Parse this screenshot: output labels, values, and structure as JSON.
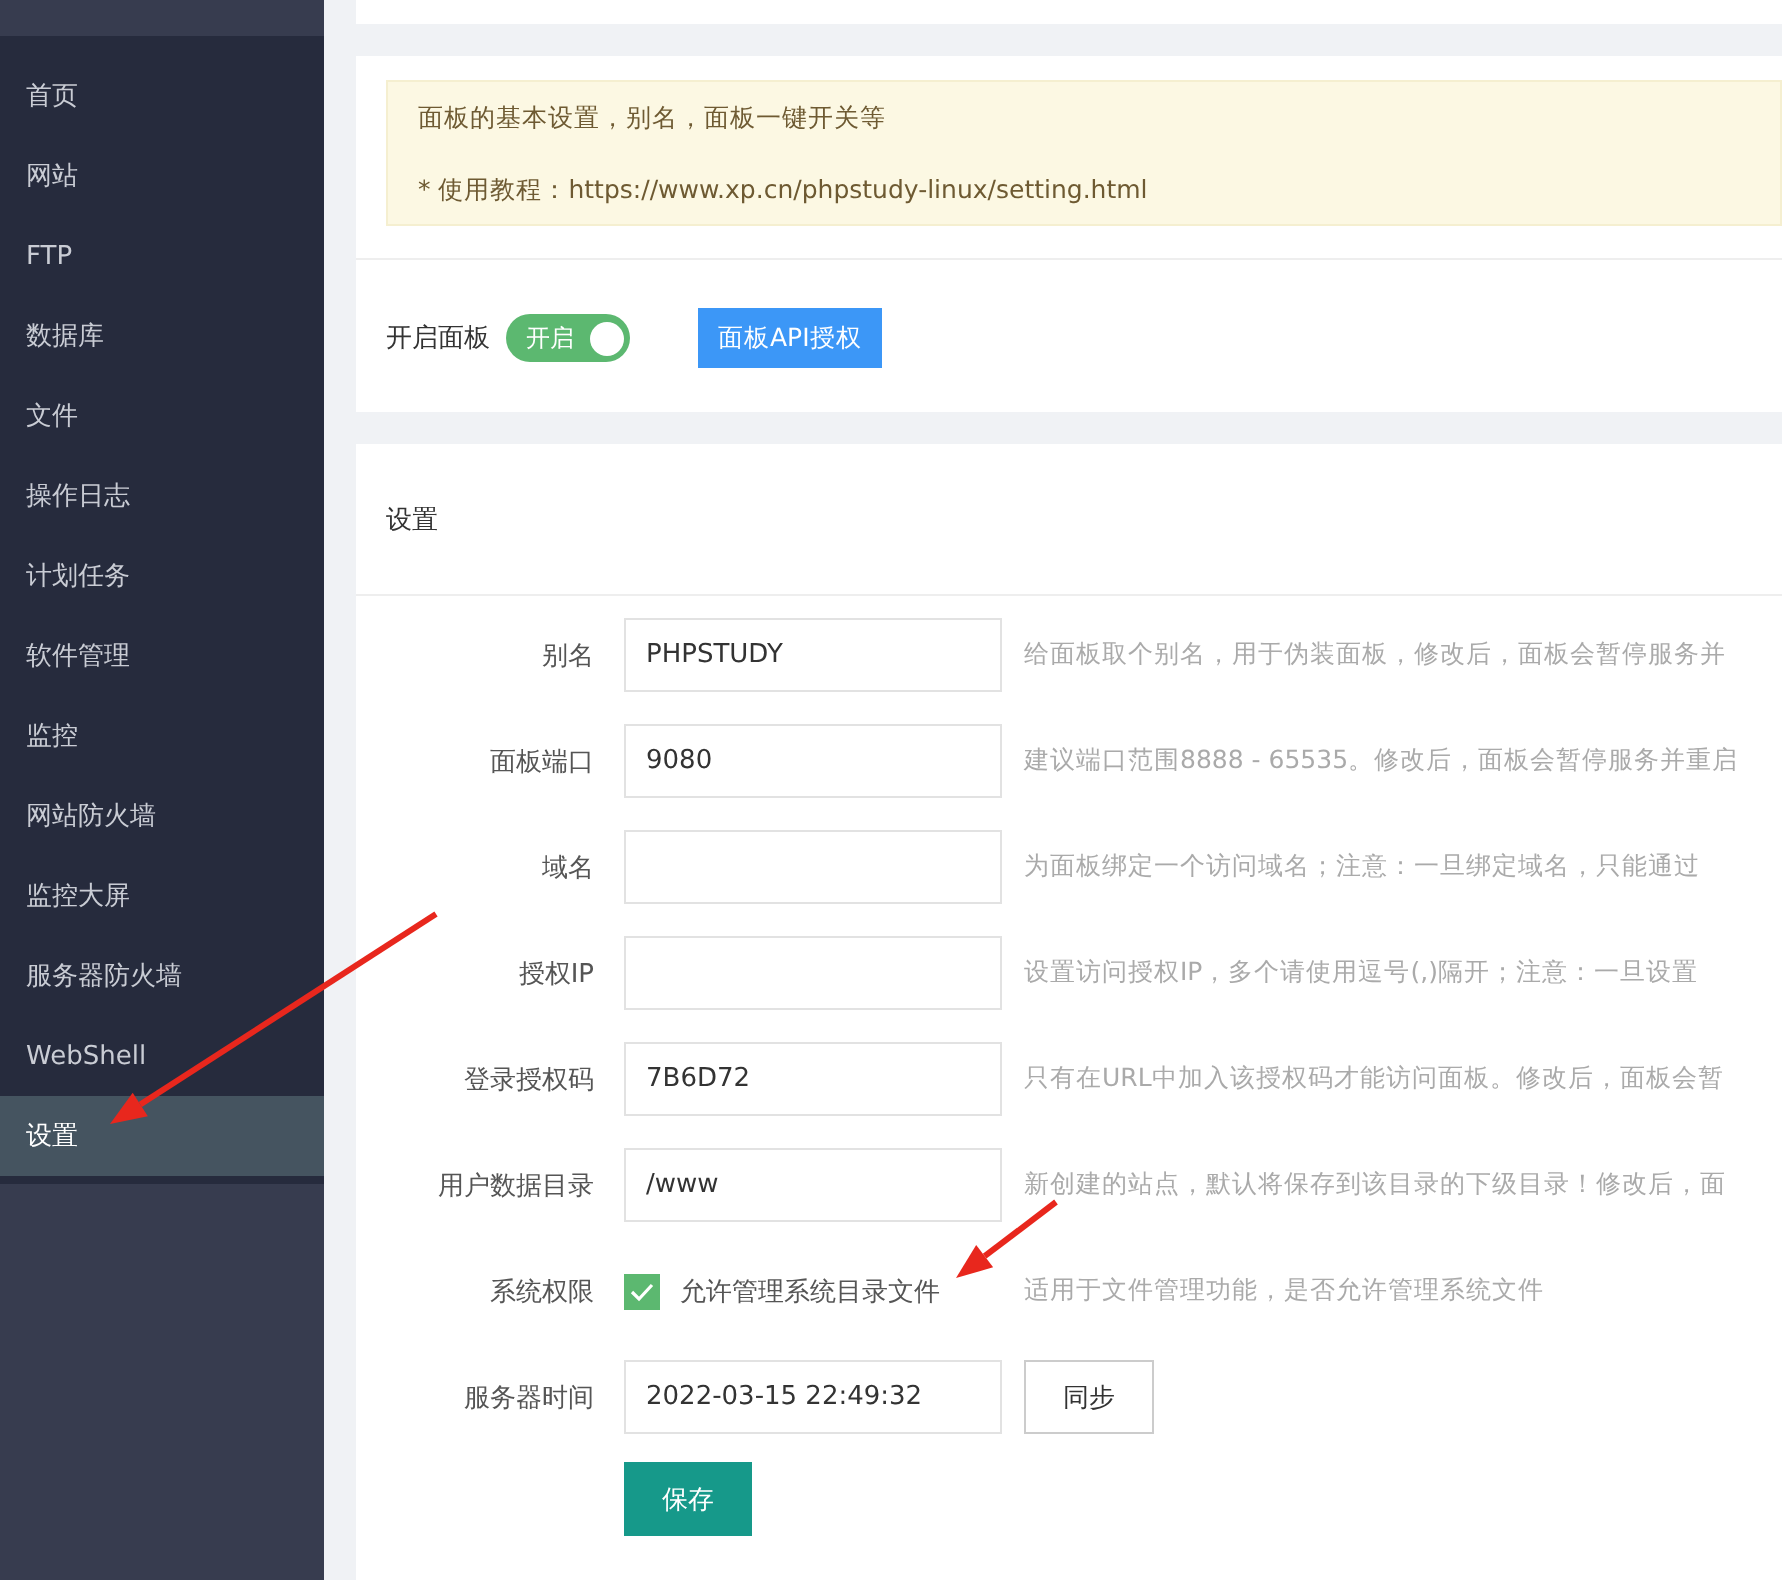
{
  "sidebar": {
    "items": [
      {
        "label": "首页",
        "selected": false
      },
      {
        "label": "网站",
        "selected": false
      },
      {
        "label": "FTP",
        "selected": false
      },
      {
        "label": "数据库",
        "selected": false
      },
      {
        "label": "文件",
        "selected": false
      },
      {
        "label": "操作日志",
        "selected": false
      },
      {
        "label": "计划任务",
        "selected": false
      },
      {
        "label": "软件管理",
        "selected": false
      },
      {
        "label": "监控",
        "selected": false
      },
      {
        "label": "网站防火墙",
        "selected": false
      },
      {
        "label": "监控大屏",
        "selected": false
      },
      {
        "label": "服务器防火墙",
        "selected": false
      },
      {
        "label": "WebShell",
        "selected": false
      },
      {
        "label": "设置",
        "selected": true
      }
    ]
  },
  "notice": {
    "lines": [
      "面板的基本设置，别名，面板一键开关等",
      "* 使用教程：https://www.xp.cn/phpstudy-linux/setting.html"
    ]
  },
  "panel_switch": {
    "label": "开启面板",
    "toggle_text": "开启",
    "on": true
  },
  "api_button": "面板API授权",
  "settings": {
    "title": "设置",
    "rows": [
      {
        "kind": "input",
        "label": "别名",
        "value": "PHPSTUDY",
        "hint": "给面板取个别名，用于伪装面板，修改后，面板会暂停服务并"
      },
      {
        "kind": "input",
        "label": "面板端口",
        "value": "9080",
        "hint": "建议端口范围8888 - 65535。修改后，面板会暂停服务并重启"
      },
      {
        "kind": "input",
        "label": "域名",
        "hint": "为面板绑定一个访问域名；注意：一旦绑定域名，只能通过"
      },
      {
        "kind": "input",
        "label": "授权IP",
        "hint": "设置访问授权IP，多个请使用逗号(,)隔开；注意：一旦设置"
      },
      {
        "kind": "input",
        "label": "登录授权码",
        "value": "7B6D72",
        "hint": "只有在URL中加入该授权码才能访问面板。修改后，面板会暂"
      },
      {
        "kind": "input",
        "label": "用户数据目录",
        "value": "/www",
        "hint": "新创建的站点，默认将保存到该目录的下级目录！修改后，面"
      },
      {
        "kind": "checkbox",
        "label": "系统权限",
        "option": "允许管理系统目录文件",
        "checked": true,
        "hint": "适用于文件管理功能，是否允许管理系统文件"
      },
      {
        "kind": "time",
        "label": "服务器时间",
        "value": "2022-03-15 22:49:32",
        "button": "同步"
      }
    ]
  },
  "save_button": "保存"
}
